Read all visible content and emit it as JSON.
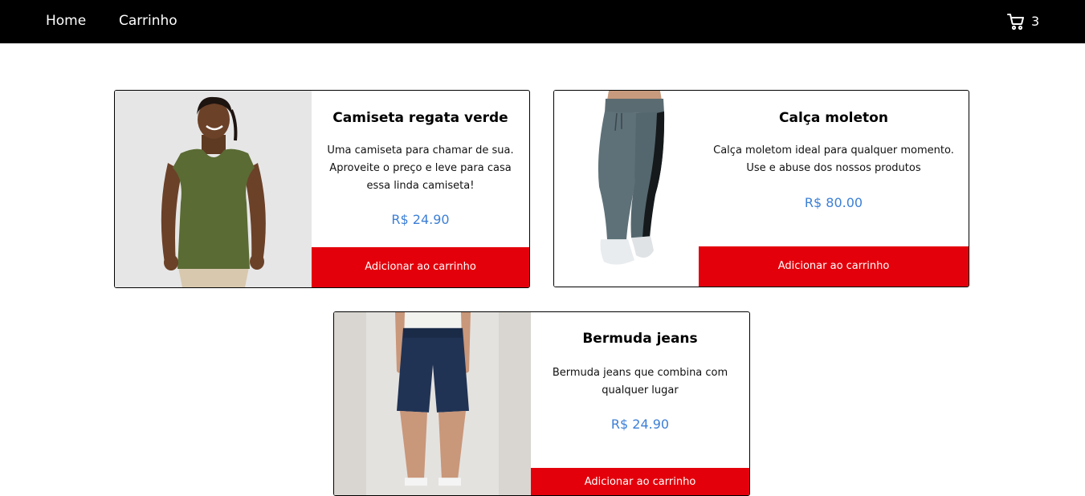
{
  "nav": {
    "home_label": "Home",
    "cart_label": "Carrinho",
    "cart_icon": "shopping-cart-icon",
    "cart_count": "3"
  },
  "products": [
    {
      "title": "Camiseta regata verde",
      "description": "Uma camiseta para chamar de sua. Aproveite o preço e leve para casa essa linda camiseta!",
      "price": "R$ 24.90",
      "button_label": "Adicionar ao carrinho",
      "image_alt": "man wearing green tank top"
    },
    {
      "title": "Calça moleton",
      "description": "Calça moletom ideal para qualquer momento. Use e abuse dos nossos produtos",
      "price": "R$ 80.00",
      "button_label": "Adicionar ao carrinho",
      "image_alt": "grey sweatpants with black stripe"
    },
    {
      "title": "Bermuda jeans",
      "description": "Bermuda jeans que combina com qualquer lugar",
      "price": "R$ 24.90",
      "button_label": "Adicionar ao carrinho",
      "image_alt": "dark denim shorts"
    }
  ],
  "colors": {
    "navbar_bg": "#000000",
    "button_bg": "#e3000b",
    "price_color": "#3c7fd6"
  }
}
